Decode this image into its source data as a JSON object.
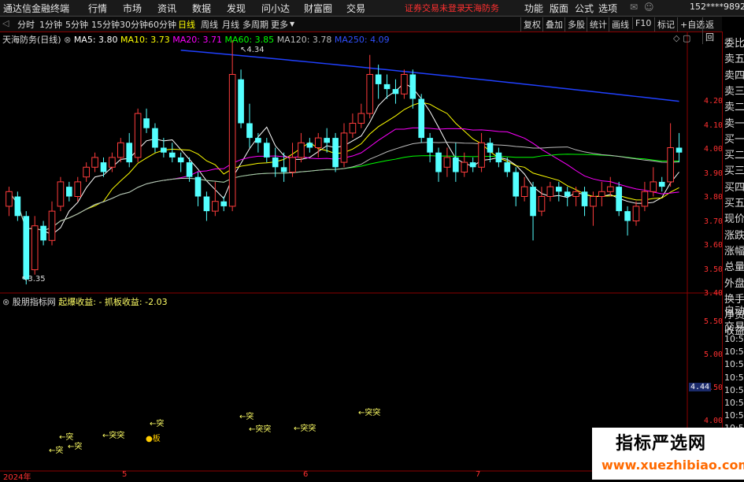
{
  "menubar": {
    "app_title": "通达信金融终端",
    "menus": [
      "行情",
      "市场",
      "资讯",
      "数据",
      "发现",
      "问小达",
      "财富圈",
      "交易"
    ],
    "status_login": "证券交易未登录",
    "status_stock": "天海防务",
    "right_menus": [
      "功能",
      "版面",
      "公式",
      "选项"
    ],
    "account": "152****9892"
  },
  "toolbar": {
    "periods": [
      "分时",
      "1分钟",
      "5分钟",
      "15分钟",
      "30分钟",
      "60分钟",
      "日线",
      "周线",
      "月线",
      "多周期",
      "更多"
    ],
    "selected": "日线",
    "right_buttons": [
      "复权",
      "叠加",
      "多股",
      "统计",
      "画线",
      "F10",
      "标记",
      "+自选",
      "返回"
    ]
  },
  "main_info": {
    "stock": "天海防务(日线)",
    "ma5": "MA5: 3.80",
    "ma10": "MA10: 3.73",
    "ma20": "MA20: 3.71",
    "ma60": "MA60: 3.85",
    "ma120": "MA120: 3.78",
    "ma250": "MA250: 4.09",
    "high_label": "4.34",
    "low_label": "3.35"
  },
  "sub_info": {
    "name": "股朋指标网",
    "field1": "起爆收益:",
    "field1_val": "-",
    "field2": "抓板收益:",
    "field2_val": "-2.03"
  },
  "signals": [
    "突",
    "突",
    "突",
    "突",
    "突",
    "突",
    "突",
    "突",
    "突",
    "突"
  ],
  "signal_board": "板",
  "right_panel": [
    "委比",
    "卖五",
    "卖四",
    "卖三",
    "卖二",
    "卖一",
    "买一",
    "买二",
    "买三",
    "买四",
    "买五",
    "现价",
    "涨跌",
    "涨幅",
    "总量",
    "外盘",
    "换手",
    "净资",
    "收益",
    "自动",
    "交易",
    "10:50",
    "10:50",
    "10:50",
    "10:51",
    "10:51",
    "10:51",
    "10:51",
    "10:51",
    "10:51",
    "10:51"
  ],
  "price_axis": [
    "4.20",
    "4.10",
    "4.00",
    "3.90",
    "3.80",
    "3.70",
    "3.60",
    "3.50",
    "3.40"
  ],
  "sub_axis": [
    "5.50",
    "5.00",
    "4.50",
    "4.00"
  ],
  "sub_axis_highlight": "4.44",
  "time_axis": [
    "2024年",
    "5",
    "6",
    "7"
  ],
  "watermark": {
    "title": "指标严选网",
    "url": "www.xuezhibiao.com"
  },
  "colors": {
    "up": "#ff3c3c",
    "down": "#54ffff",
    "ma5": "#ffffff",
    "ma10": "#ffff00",
    "ma20": "#ff00ff",
    "ma60": "#00ff00",
    "ma120": "#bbbbbb",
    "ma250": "#2040ff"
  },
  "chart_data": {
    "type": "candlestick",
    "ylim": [
      3.35,
      4.35
    ],
    "candles": [
      [
        3.66,
        3.72,
        3.62,
        3.74
      ],
      [
        3.7,
        3.62,
        3.6,
        3.72
      ],
      [
        3.62,
        3.36,
        3.34,
        3.64
      ],
      [
        3.4,
        3.58,
        3.38,
        3.62
      ],
      [
        3.58,
        3.52,
        3.5,
        3.6
      ],
      [
        3.52,
        3.64,
        3.5,
        3.68
      ],
      [
        3.66,
        3.76,
        3.64,
        3.78
      ],
      [
        3.74,
        3.7,
        3.68,
        3.76
      ],
      [
        3.7,
        3.76,
        3.68,
        3.78
      ],
      [
        3.78,
        3.82,
        3.76,
        3.84
      ],
      [
        3.82,
        3.86,
        3.8,
        3.88
      ],
      [
        3.84,
        3.8,
        3.78,
        3.86
      ],
      [
        3.82,
        3.86,
        3.8,
        3.88
      ],
      [
        3.86,
        3.92,
        3.84,
        3.94
      ],
      [
        3.92,
        3.84,
        3.82,
        3.96
      ],
      [
        3.86,
        4.04,
        3.84,
        4.06
      ],
      [
        4.02,
        3.98,
        3.96,
        4.06
      ],
      [
        3.98,
        3.9,
        3.88,
        4.0
      ],
      [
        3.9,
        3.88,
        3.86,
        3.94
      ],
      [
        3.88,
        3.86,
        3.84,
        3.92
      ],
      [
        3.86,
        3.84,
        3.8,
        3.88
      ],
      [
        3.84,
        3.78,
        3.76,
        3.86
      ],
      [
        3.78,
        3.7,
        3.66,
        3.8
      ],
      [
        3.7,
        3.64,
        3.6,
        3.72
      ],
      [
        3.64,
        3.68,
        3.62,
        3.76
      ],
      [
        3.68,
        3.66,
        3.64,
        3.7
      ],
      [
        3.66,
        4.2,
        3.64,
        4.34
      ],
      [
        4.18,
        4.0,
        3.98,
        4.22
      ],
      [
        4.0,
        3.94,
        3.9,
        4.08
      ],
      [
        3.94,
        3.92,
        3.88,
        3.96
      ],
      [
        3.92,
        3.86,
        3.84,
        3.94
      ],
      [
        3.86,
        3.82,
        3.78,
        3.9
      ],
      [
        3.82,
        3.8,
        3.76,
        3.88
      ],
      [
        3.8,
        3.86,
        3.78,
        3.92
      ],
      [
        3.86,
        3.92,
        3.84,
        3.96
      ],
      [
        3.92,
        3.9,
        3.88,
        3.94
      ],
      [
        3.9,
        3.94,
        3.86,
        3.96
      ],
      [
        3.94,
        3.92,
        3.88,
        3.98
      ],
      [
        3.94,
        3.82,
        3.8,
        3.96
      ],
      [
        3.84,
        3.96,
        3.82,
        4.0
      ],
      [
        3.96,
        4.0,
        3.94,
        4.04
      ],
      [
        4.0,
        4.04,
        3.98,
        4.08
      ],
      [
        4.04,
        4.2,
        4.02,
        4.28
      ],
      [
        4.2,
        4.16,
        4.1,
        4.24
      ],
      [
        4.16,
        4.14,
        4.1,
        4.2
      ],
      [
        4.14,
        4.12,
        4.08,
        4.18
      ],
      [
        4.12,
        4.2,
        4.1,
        4.22
      ],
      [
        4.2,
        4.1,
        4.06,
        4.22
      ],
      [
        4.1,
        3.94,
        3.92,
        4.12
      ],
      [
        3.94,
        3.88,
        3.84,
        3.96
      ],
      [
        3.88,
        3.8,
        3.76,
        3.9
      ],
      [
        3.82,
        3.86,
        3.78,
        3.9
      ],
      [
        3.86,
        3.8,
        3.76,
        3.92
      ],
      [
        3.8,
        3.84,
        3.78,
        3.88
      ],
      [
        3.84,
        3.82,
        3.8,
        3.86
      ],
      [
        3.82,
        3.92,
        3.8,
        3.96
      ],
      [
        3.92,
        3.88,
        3.84,
        3.94
      ],
      [
        3.88,
        3.84,
        3.82,
        3.9
      ],
      [
        3.84,
        3.8,
        3.78,
        3.86
      ],
      [
        3.8,
        3.7,
        3.66,
        3.82
      ],
      [
        3.7,
        3.74,
        3.68,
        3.78
      ],
      [
        3.74,
        3.62,
        3.52,
        3.76
      ],
      [
        3.64,
        3.7,
        3.62,
        3.74
      ],
      [
        3.7,
        3.74,
        3.68,
        3.76
      ],
      [
        3.74,
        3.72,
        3.68,
        3.76
      ],
      [
        3.72,
        3.7,
        3.66,
        3.74
      ],
      [
        3.7,
        3.72,
        3.66,
        3.74
      ],
      [
        3.72,
        3.66,
        3.62,
        3.74
      ],
      [
        3.66,
        3.7,
        3.58,
        3.72
      ],
      [
        3.7,
        3.72,
        3.66,
        3.76
      ],
      [
        3.72,
        3.74,
        3.7,
        3.78
      ],
      [
        3.74,
        3.64,
        3.62,
        3.76
      ],
      [
        3.64,
        3.6,
        3.54,
        3.66
      ],
      [
        3.6,
        3.66,
        3.58,
        3.68
      ],
      [
        3.66,
        3.72,
        3.64,
        3.76
      ],
      [
        3.72,
        3.76,
        3.7,
        3.82
      ],
      [
        3.76,
        3.74,
        3.72,
        3.78
      ],
      [
        3.76,
        3.9,
        3.74,
        4.0
      ],
      [
        3.9,
        3.88,
        3.84,
        3.96
      ]
    ]
  }
}
